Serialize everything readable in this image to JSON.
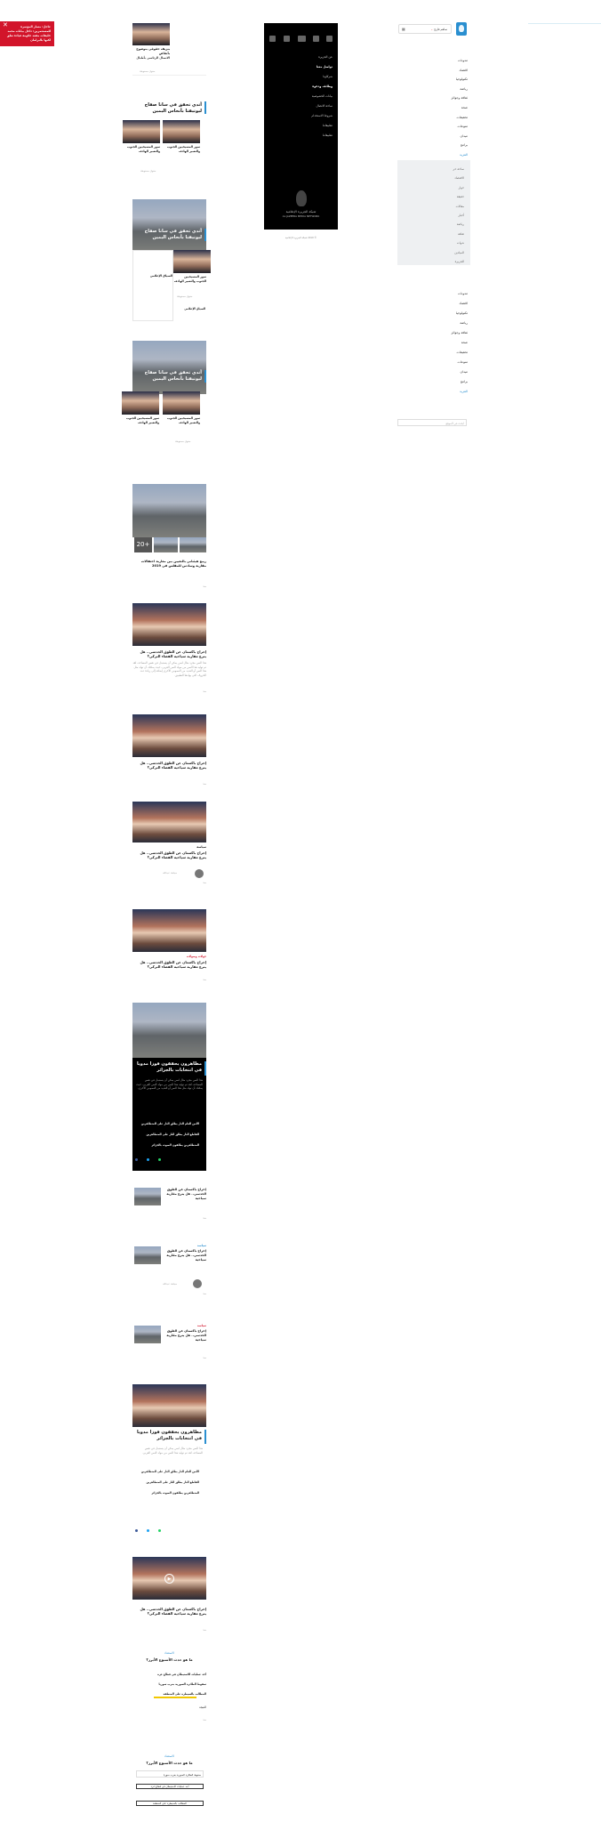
{
  "alert": {
    "text": "عاجل: مسار المؤتمرة للمستثمرين: داخل بيانات محمد خليفات مقعد حكومة قيادة تعلق لكنها بالبرلمان"
  },
  "header": {
    "search_label": "ساهم قارئ",
    "search_chevron": "⌄"
  },
  "nav": {
    "items": [
      "مدونات",
      "اقتصاد",
      "تكنولوجيا",
      "رياضة",
      "ثقافة وجوائز",
      "صحة",
      "تحقيقات",
      "منوعات",
      "ميدان",
      "برامج",
      "المزيد"
    ],
    "more_items": [
      "ساحة حر",
      "الاقتصاد",
      "حوار",
      "حقيقة",
      "مقالات",
      "أخبار",
      "رياضة",
      "ثقافة",
      "ندوات",
      "الميادين",
      "الجزيرة"
    ],
    "items2": [
      "مدونات",
      "اقتصاد",
      "تكنولوجيا",
      "رياضة",
      "ثقافة وجوائز",
      "صحة",
      "تحقيقات",
      "منوعات",
      "ميدان",
      "برامج",
      "المزيد"
    ],
    "search_placeholder": "ابحث في الموقع"
  },
  "black_menu": {
    "items": [
      "عن الجزيرة",
      "تواصل معنا",
      "شركاؤنا",
      "وظائف ودعوة",
      "بيانات الخصوصية",
      "ساحة الاتصال",
      "شروط الاستخدام",
      "تطبيقاتنا",
      "تطبيقاتنا"
    ],
    "network_name": "شبكة الجزيرة الإعلامية",
    "network_en": "AL JAZEERA MEDIA NETWORK",
    "copyright": "© 2019 شبكة الجزيرة الإعلامية"
  },
  "cards": {
    "c1": {
      "title": "بنزيف حقوقي بنوضوح بأنقاض",
      "sub": "الاتصال الرئاسي بأطبال",
      "meta": "حقوق محفوظة"
    },
    "c2": {
      "title": "أتدي تحقق في سانا صفاح ليوتيقتا بأنحاس اليمين",
      "sub1": "سور المسيحيين الجنوب والتعبير الهادف",
      "sub2": "سور المسيحيين الجنوب والتعبير الهادف",
      "meta": "حقوق محفوظة"
    },
    "c3": {
      "title": "أتدي تحقق في سانا صفاح ليوتيقتا بأنحاس اليمين",
      "sub1": "سور المسيحيين الجنوب والتعبير الهادف",
      "sub2": "السياق الإعلامي",
      "tag": "السياق الإعلامي",
      "meta": "حقوق محفوظة"
    },
    "c4": {
      "title": "أتدي تحقق في سانا صفاح ليوتيقتا بأنحاس اليمين",
      "sub1": "سور المسيحيين الجنوب والتعبير الهادف",
      "sub2": "سور المسيحيين الجنوب والتعبير الهادف",
      "meta": "حقوق محفوظة"
    },
    "c5": {
      "title": "ربيع هيئناني بالتعيين بين مغاربة احتفالات مقاربة وسادس للمقلس في 2019",
      "badge": "+20",
      "meta": "منذ"
    },
    "c6": {
      "title": "إخراج باكستان عن الطوق الحدسي.. هل يترع مقاربة سياحية الفضاء التركي؟",
      "body": "هذا النص مجرد مثال لنص يمكن أن يستبدل في نفس المساحة، لقد تم توليد هذا النص من مولد النص العربى، حيث يمكنك أن تولد مثل هذا النص أو العديد من النصوص الأخرى إضافة إلى زيادة عدد الحروف التى يولدها التطبيق.",
      "meta": "منذ"
    },
    "c7": {
      "title": "إخراج باكستان عن الطوق الحدسي.. هل يترع مقاربة سياحية الفضاء التركي؟",
      "meta": "منذ"
    },
    "c8": {
      "tag": "سياسة",
      "title": "إخراج باكستان عن الطوق الحدسي.. هل يترع مقاربة سياحية الفضاء التركي؟",
      "author": "مجاهد عبدالله",
      "meta": "منذ"
    },
    "c9": {
      "tag": "جولات وصولات",
      "title": "إخراج باكستان عن الطوق الحدسي.. هل يترع مقاربة سياحية الفضاء التركي؟",
      "meta": "منذ"
    },
    "c10": {
      "title": "مظاهرون يحققون فوزا مدويا في انتخابات بالجزائر",
      "body": "هذا النص مجرد مثال لنص يمكن أن يستبدل في نفس المساحة، لقد تم توليد هذا النص من مولد النص العربى، حيث يمكنك أن تولد مثل هذا النص أو العديد من النصوص الأخرى.",
      "l1": "الأمن العام النار يطلق النار على المتظاهرين",
      "l2": "القاطع النار يطلق النار على المتظاهرين",
      "l3": "المتظاهرين يطلقون الصوت بالجزائر"
    },
    "c11": {
      "title": "إخراج باكستان عن الطوق الحدسي.. هل يترع مقاربة سياحية",
      "meta": "منذ"
    },
    "c12": {
      "tag": "سياسة",
      "title": "إخراج باكستان عن الطوق الحدسي.. هل يترع مقاربة سياحية",
      "author": "مجاهد عبدالله",
      "meta": "منذ"
    },
    "c13": {
      "tag": "سياسة",
      "title": "إخراج باكستان عن الطوق الحدسي.. هل يترع مقاربة سياحية",
      "meta": "منذ"
    },
    "c14": {
      "title": "مظاهرون يحققون فوزا مدويا في انتخابات بالجزائر",
      "body": "هذا النص مجرد مثال لنص يمكن أن يستبدل في نفس المساحة، لقد تم توليد هذا النص من مولد النص العربى.",
      "l1": "الأمن العام النار يطلق النار على المتظاهرين",
      "l2": "القاطع النار يطلق النار على المتظاهرين",
      "l3": "المتظاهرين يطلقون الصوت بالجزائر"
    },
    "c15": {
      "title": "إخراج باكستان عن الطوق الحدسي.. هل يترع مقاربة سياحية الفضاء التركي؟",
      "meta": "منذ"
    }
  },
  "poll1": {
    "kicker": "الاستفتاء",
    "title": "ما هو حدث الأسبوع الأبرز؟",
    "options": [
      "أحد عمليات الاستيطان في قطاع غزة",
      "سقوط الطائرة السورية بغرب سوريا",
      "المطالب بالسيطرة على المنطقة"
    ],
    "result": "النتيجة",
    "meta": "منذ"
  },
  "poll2": {
    "kicker": "الاستفتاء",
    "title": "ما هو حدث الأسبوع الأبرز؟",
    "input": "سقوط الطائرة السورية بغرب سوريا",
    "btn1": "أحد عمليات الاستيطان في قطاع غزة",
    "btn2": "المطالب بالسيطرة على المنطقة"
  }
}
